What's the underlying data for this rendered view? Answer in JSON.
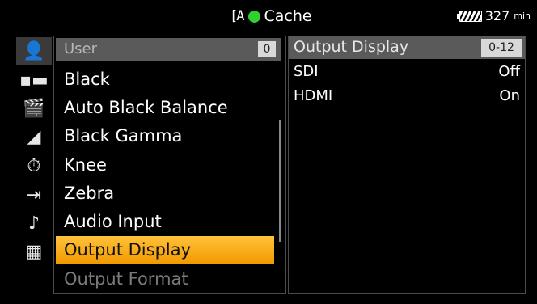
{
  "status_bar": {
    "media_icon": "[A",
    "rec_indicator_color": "#2fd12f",
    "cache_label": "Cache",
    "battery_icon": "battery-icon",
    "battery_value": "327",
    "battery_unit": "min"
  },
  "sidebar": {
    "icons": [
      {
        "name": "user-menu-icon",
        "glyph": "👤",
        "active": true
      },
      {
        "name": "camera-icon",
        "glyph": "▪▬",
        "active": false
      },
      {
        "name": "clapper-icon",
        "glyph": "🎬",
        "active": false
      },
      {
        "name": "paint-icon",
        "glyph": "◢",
        "active": false
      },
      {
        "name": "timecode-icon",
        "glyph": "⏱",
        "active": false
      },
      {
        "name": "output-icon",
        "glyph": "⇥",
        "active": false
      },
      {
        "name": "audio-icon",
        "glyph": "♪",
        "active": false
      },
      {
        "name": "checker-icon",
        "glyph": "▦",
        "active": false
      }
    ]
  },
  "list": {
    "header_label": "User",
    "header_badge": "0",
    "items": [
      {
        "label": "Black",
        "state": "normal"
      },
      {
        "label": "Auto Black Balance",
        "state": "normal"
      },
      {
        "label": "Black Gamma",
        "state": "normal"
      },
      {
        "label": "Knee",
        "state": "normal"
      },
      {
        "label": "Zebra",
        "state": "normal"
      },
      {
        "label": "Audio Input",
        "state": "normal"
      },
      {
        "label": "Output Display",
        "state": "selected"
      },
      {
        "label": "Output Format",
        "state": "disabled"
      }
    ]
  },
  "detail": {
    "title": "Output Display",
    "range": "0-12",
    "rows": [
      {
        "label": "SDI",
        "value": "Off"
      },
      {
        "label": "HDMI",
        "value": "On"
      }
    ]
  },
  "colors": {
    "accent": "#f29a00",
    "header_bg": "#5a5a5a",
    "active_icon": "#ffb400"
  }
}
